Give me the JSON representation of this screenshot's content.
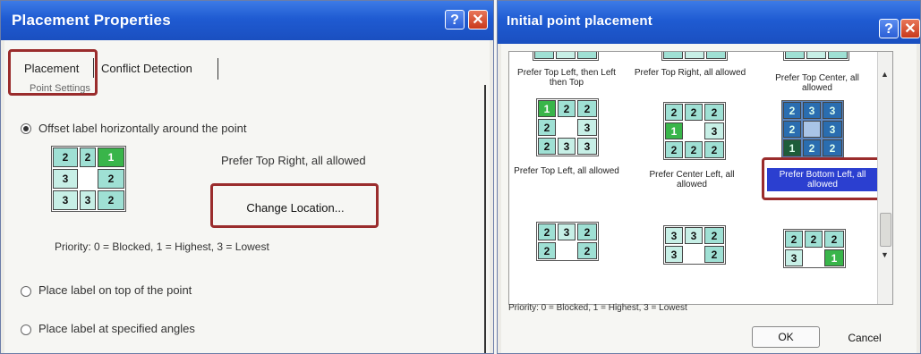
{
  "left_window": {
    "title": "Placement Properties",
    "help_button": "?",
    "close_button": "✕",
    "tabs": [
      "Placement",
      "Conflict Detection"
    ],
    "group_label": "Point Settings",
    "options": [
      {
        "label": "Offset label horizontally around the point",
        "selected": true
      },
      {
        "label": "Place label on top of the point",
        "selected": false
      },
      {
        "label": "Place label at specified angles",
        "selected": false
      }
    ],
    "grid": [
      [
        "2",
        "2",
        "1"
      ],
      [
        "3",
        "",
        "2"
      ],
      [
        "3",
        "3",
        "2"
      ]
    ],
    "preference_text": "Prefer Top Right, all allowed",
    "change_location_button": "Change Location...",
    "priority_text": "Priority:  0 = Blocked, 1 = Highest, 3 = Lowest"
  },
  "right_window": {
    "title": "Initial point placement",
    "help_button": "?",
    "close_button": "✕",
    "top_labels": [
      "Prefer Top Left, then Left then Top",
      "Prefer Top Right, all allowed",
      "Prefer Top Center, all allowed"
    ],
    "middle_labels": [
      "Prefer Top Left, all allowed",
      "Prefer Center Left, all allowed",
      "Prefer Bottom Left, all allowed"
    ],
    "grid_top_left": [
      [
        "1",
        "2",
        "2"
      ],
      [
        "2",
        "",
        "3"
      ],
      [
        "2",
        "3",
        "3"
      ]
    ],
    "grid_center_left": [
      [
        "2",
        "2",
        "2"
      ],
      [
        "1",
        "",
        "3"
      ],
      [
        "2",
        "2",
        "2"
      ]
    ],
    "grid_bottom_left": [
      [
        "2",
        "3",
        "3"
      ],
      [
        "2",
        "",
        "3"
      ],
      [
        "1",
        "2",
        "2"
      ]
    ],
    "grid_bottom_row_1": [
      [
        "2",
        "3",
        "2"
      ],
      [
        "2",
        "",
        "2"
      ]
    ],
    "grid_bottom_row_2": [
      [
        "3",
        "3",
        "2"
      ],
      [
        "3",
        "",
        "2"
      ]
    ],
    "grid_bottom_row_3": [
      [
        "2",
        "2",
        "2"
      ],
      [
        "3",
        "",
        "1"
      ]
    ],
    "priority_text": "Priority:  0 = Blocked, 1 = Highest, 3 = Lowest",
    "ok_button": "OK",
    "cancel_button": "Cancel",
    "scroll_up": "▲",
    "scroll_down": "▼"
  }
}
